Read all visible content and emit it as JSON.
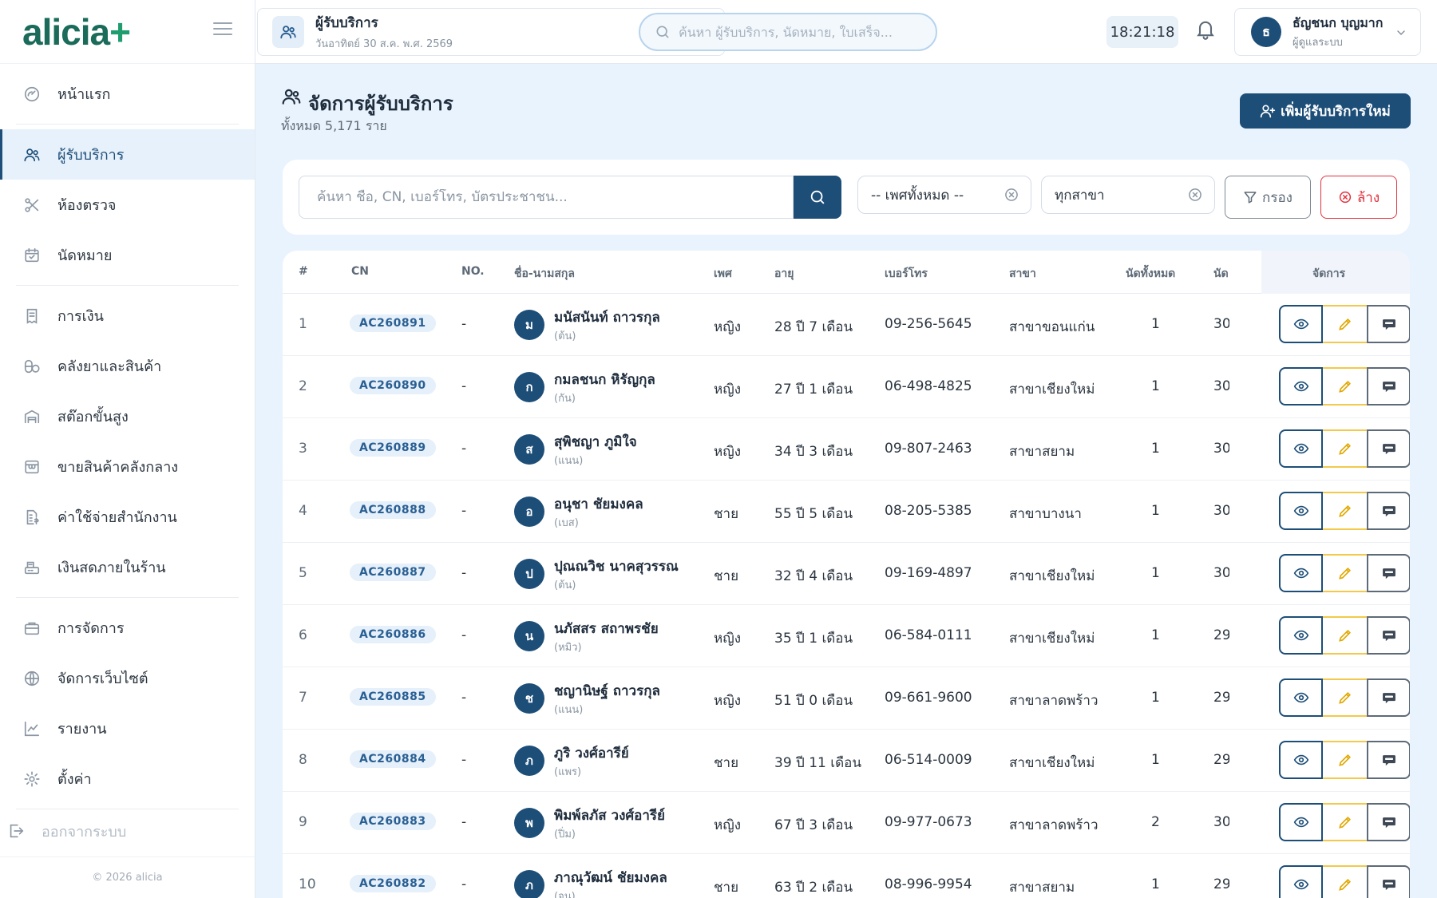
{
  "brand": {
    "name": "alicia",
    "plus": "+"
  },
  "sidebar": {
    "groups": [
      [
        {
          "label": "หน้าแรก",
          "icon": "dashboard-icon"
        }
      ],
      [
        {
          "label": "ผู้รับบริการ",
          "icon": "users-icon",
          "active": true
        },
        {
          "label": "ห้องตรวจ",
          "icon": "scissors-icon"
        },
        {
          "label": "นัดหมาย",
          "icon": "calendar-icon"
        }
      ],
      [
        {
          "label": "การเงิน",
          "icon": "receipt-icon"
        },
        {
          "label": "คลังยาและสินค้า",
          "icon": "pills-icon"
        },
        {
          "label": "สต๊อกขั้นสูง",
          "icon": "warehouse-icon"
        },
        {
          "label": "ขายสินค้าคลังกลาง",
          "icon": "store-icon"
        },
        {
          "label": "ค่าใช้จ่ายสำนักงาน",
          "icon": "expense-icon"
        },
        {
          "label": "เงินสดภายในร้าน",
          "icon": "cash-register-icon"
        }
      ],
      [
        {
          "label": "การจัดการ",
          "icon": "briefcase-icon"
        },
        {
          "label": "จัดการเว็บไซต์",
          "icon": "globe-icon"
        },
        {
          "label": "รายงาน",
          "icon": "chart-line-icon"
        },
        {
          "label": "ตั้งค่า",
          "icon": "gear-icon"
        }
      ]
    ],
    "logout": "ออกจากระบบ",
    "copyright": "© 2026 alicia"
  },
  "topbar": {
    "page_title": "ผู้รับบริการ",
    "page_date": "วันอาทิตย์ 30 ส.ค. พ.ศ. 2569",
    "search_placeholder": "ค้นหา ผู้รับบริการ, นัดหมาย, ใบเสร็จ...",
    "clock": "18:21:18",
    "user_initial": "ธ",
    "user_name": "ธัญชนก บุญมาก",
    "user_role": "ผู้ดูแลระบบ"
  },
  "main": {
    "title": "จัดการผู้รับบริการ",
    "total": "ทั้งหมด 5,171 ราย",
    "add_button": "เพิ่มผู้รับบริการใหม่"
  },
  "filters": {
    "search_placeholder": "ค้นหา ชื่อ, CN, เบอร์โทร, บัตรประชาชน...",
    "gender": "-- เพศทั้งหมด --",
    "branch": "ทุกสาขา",
    "filter_button": "กรอง",
    "clear_button": "ล้าง"
  },
  "table": {
    "headers": {
      "num": "#",
      "cn": "CN",
      "no": "NO.",
      "name": "ชื่อ-นามสกุล",
      "gender": "เพศ",
      "age": "อายุ",
      "phone": "เบอร์โทร",
      "branch": "สาขา",
      "visits": "นัดทั้งหมด",
      "cut": "นัด",
      "actions": "จัดการ"
    },
    "rows": [
      {
        "num": "1",
        "cn": "AC260891",
        "no": "-",
        "initial": "ม",
        "name": "มนัสนันท์ ถาวรกุล",
        "nick": "(ต้น)",
        "gender": "หญิง",
        "age": "28 ปี 7 เดือน",
        "phone": "09-256-5645",
        "branch": "สาขาขอนแก่น",
        "visits": "1",
        "cut": "30"
      },
      {
        "num": "2",
        "cn": "AC260890",
        "no": "-",
        "initial": "ก",
        "name": "กมลชนก หิรัญกุล",
        "nick": "(กัน)",
        "gender": "หญิง",
        "age": "27 ปี 1 เดือน",
        "phone": "06-498-4825",
        "branch": "สาขาเชียงใหม่",
        "visits": "1",
        "cut": "30"
      },
      {
        "num": "3",
        "cn": "AC260889",
        "no": "-",
        "initial": "ส",
        "name": "สุพิชญา ภูมิใจ",
        "nick": "(แนน)",
        "gender": "หญิง",
        "age": "34 ปี 3 เดือน",
        "phone": "09-807-2463",
        "branch": "สาขาสยาม",
        "visits": "1",
        "cut": "30"
      },
      {
        "num": "4",
        "cn": "AC260888",
        "no": "-",
        "initial": "อ",
        "name": "อนุชา ชัยมงคล",
        "nick": "(เบส)",
        "gender": "ชาย",
        "age": "55 ปี 5 เดือน",
        "phone": "08-205-5385",
        "branch": "สาขาบางนา",
        "visits": "1",
        "cut": "30"
      },
      {
        "num": "5",
        "cn": "AC260887",
        "no": "-",
        "initial": "ป",
        "name": "ปุณณวิช นาคสุวรรณ",
        "nick": "(ต้น)",
        "gender": "ชาย",
        "age": "32 ปี 4 เดือน",
        "phone": "09-169-4897",
        "branch": "สาขาเชียงใหม่",
        "visits": "1",
        "cut": "30"
      },
      {
        "num": "6",
        "cn": "AC260886",
        "no": "-",
        "initial": "น",
        "name": "นภัสสร สถาพรชัย",
        "nick": "(หมิว)",
        "gender": "หญิง",
        "age": "35 ปี 1 เดือน",
        "phone": "06-584-0111",
        "branch": "สาขาเชียงใหม่",
        "visits": "1",
        "cut": "29"
      },
      {
        "num": "7",
        "cn": "AC260885",
        "no": "-",
        "initial": "ช",
        "name": "ชญานิษฐ์ ถาวรกุล",
        "nick": "(แนน)",
        "gender": "หญิง",
        "age": "51 ปี 0 เดือน",
        "phone": "09-661-9600",
        "branch": "สาขาลาดพร้าว",
        "visits": "1",
        "cut": "29"
      },
      {
        "num": "8",
        "cn": "AC260884",
        "no": "-",
        "initial": "ภ",
        "name": "ภูริ วงศ์อารีย์",
        "nick": "(แพร)",
        "gender": "ชาย",
        "age": "39 ปี 11 เดือน",
        "phone": "06-514-0009",
        "branch": "สาขาเชียงใหม่",
        "visits": "1",
        "cut": "29"
      },
      {
        "num": "9",
        "cn": "AC260883",
        "no": "-",
        "initial": "พ",
        "name": "พิมพ์ลภัส วงศ์อารีย์",
        "nick": "(ปิ่ม)",
        "gender": "หญิง",
        "age": "67 ปี 3 เดือน",
        "phone": "09-977-0673",
        "branch": "สาขาลาดพร้าว",
        "visits": "2",
        "cut": "30"
      },
      {
        "num": "10",
        "cn": "AC260882",
        "no": "-",
        "initial": "ภ",
        "name": "ภาณุวัฒน์ ชัยมงคล",
        "nick": "(จูน)",
        "gender": "ชาย",
        "age": "63 ปี 2 เดือน",
        "phone": "08-996-9954",
        "branch": "สาขาสยาม",
        "visits": "1",
        "cut": "29"
      }
    ]
  },
  "colors": {
    "primary": "#1d4e78",
    "accent": "#1f9d6e",
    "danger": "#e3323e",
    "warning": "#f2c94c",
    "background": "#e9f3fd"
  }
}
